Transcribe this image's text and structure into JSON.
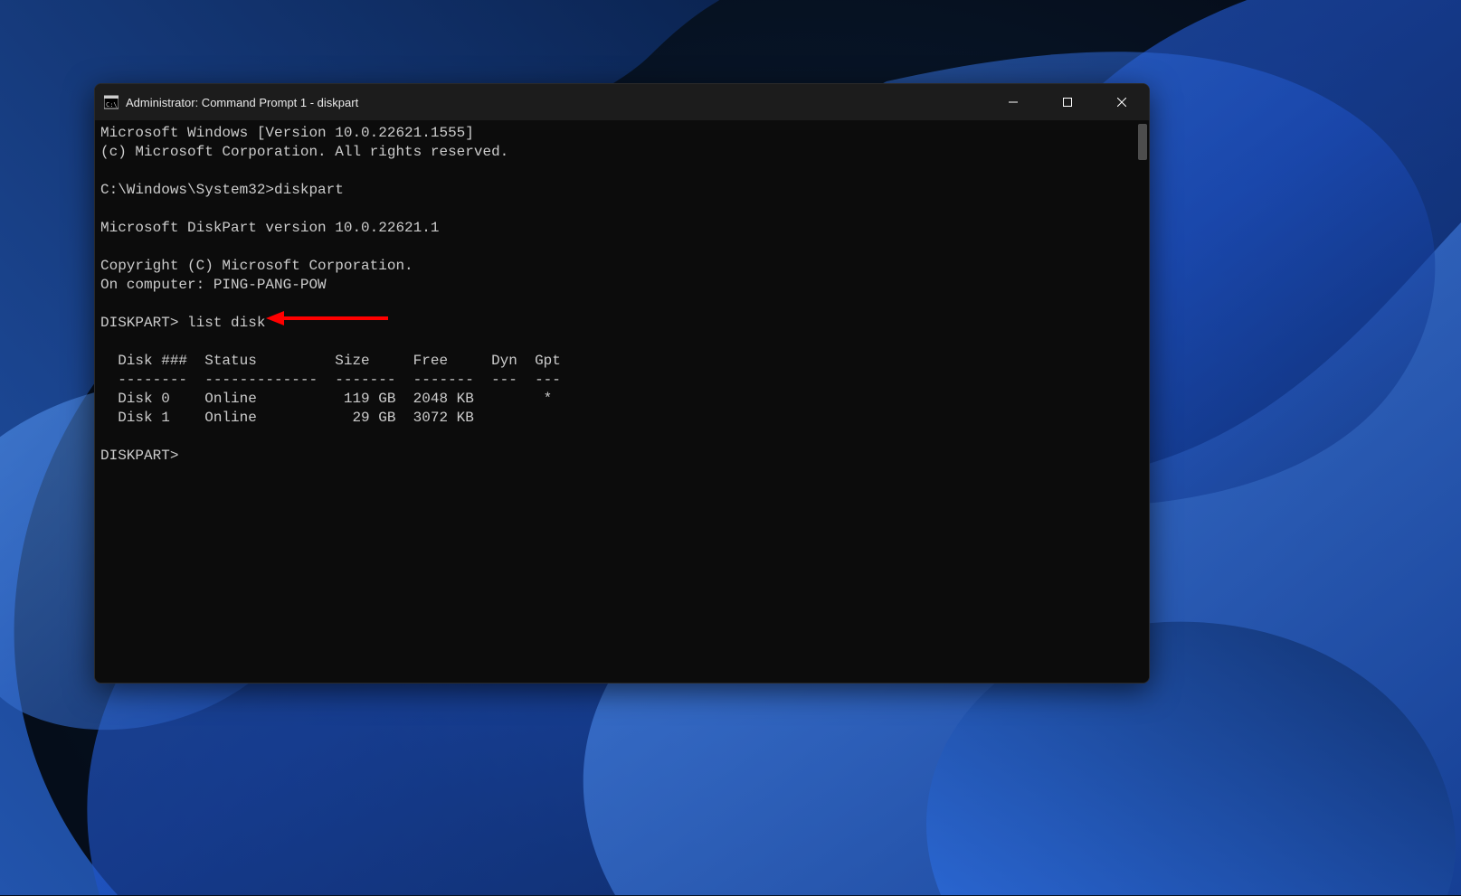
{
  "window": {
    "title": "Administrator: Command Prompt 1 - diskpart"
  },
  "terminal": {
    "line1": "Microsoft Windows [Version 10.0.22621.1555]",
    "line2": "(c) Microsoft Corporation. All rights reserved.",
    "blank1": "",
    "line3": "C:\\Windows\\System32>diskpart",
    "blank2": "",
    "line4": "Microsoft DiskPart version 10.0.22621.1",
    "blank3": "",
    "line5": "Copyright (C) Microsoft Corporation.",
    "line6": "On computer: PING-PANG-POW",
    "blank4": "",
    "line7": "DISKPART> list disk",
    "blank5": "",
    "header": "  Disk ###  Status         Size     Free     Dyn  Gpt",
    "divider": "  --------  -------------  -------  -------  ---  ---",
    "row0": "  Disk 0    Online          119 GB  2048 KB        *",
    "row1": "  Disk 1    Online           29 GB  3072 KB",
    "blank6": "",
    "line8": "DISKPART>"
  },
  "disk_table": {
    "columns": [
      "Disk ###",
      "Status",
      "Size",
      "Free",
      "Dyn",
      "Gpt"
    ],
    "rows": [
      {
        "disk": "Disk 0",
        "status": "Online",
        "size": "119 GB",
        "free": "2048 KB",
        "dyn": "",
        "gpt": "*"
      },
      {
        "disk": "Disk 1",
        "status": "Online",
        "size": "29 GB",
        "free": "3072 KB",
        "dyn": "",
        "gpt": ""
      }
    ]
  },
  "annotation": {
    "color": "#ff0000"
  }
}
